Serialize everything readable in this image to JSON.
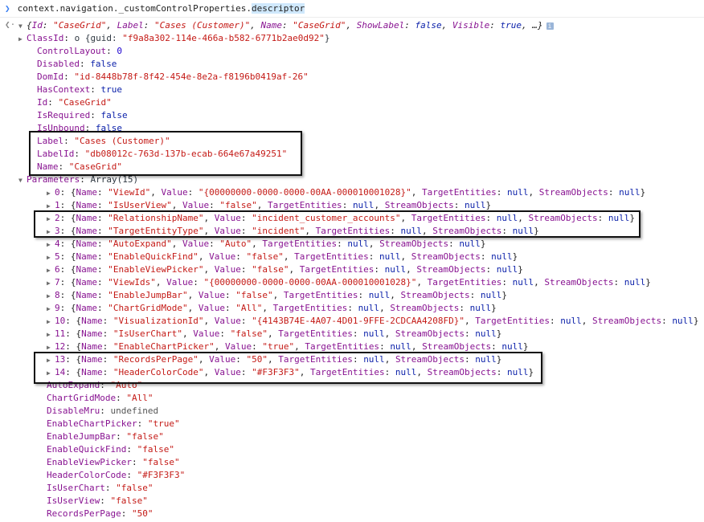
{
  "prompt": {
    "expression_prefix": "context.navigation._customControlProperties.",
    "expression_selected": "descriptor"
  },
  "summary": {
    "open": "{",
    "id_key": "Id",
    "id_val": "\"CaseGrid\"",
    "label_key": "Label",
    "label_val": "\"Cases (Customer)\"",
    "name_key": "Name",
    "name_val": "\"CaseGrid\"",
    "showlabel_key": "ShowLabel",
    "showlabel_val": "false",
    "visible_key": "Visible",
    "visible_val": "true",
    "tail": "…}",
    "info": "i"
  },
  "props_top": [
    {
      "key": "ClassId",
      "expandable": true,
      "prefix": "o ",
      "value": "{guid: ",
      "str": "\"f9a8a302-114e-466a-b582-6771b2ae0d92\"",
      "suffix": "}",
      "vtype": "plain"
    },
    {
      "key": "ControlLayout",
      "value": "0",
      "vtype": "num"
    },
    {
      "key": "Disabled",
      "value": "false",
      "vtype": "kw"
    },
    {
      "key": "DomId",
      "value": "\"id-8448b78f-8f42-454e-8e2a-f8196b0419af-26\"",
      "vtype": "str"
    },
    {
      "key": "HasContext",
      "value": "true",
      "vtype": "kw"
    },
    {
      "key": "Id",
      "value": "\"CaseGrid\"",
      "vtype": "str"
    },
    {
      "key": "IsRequired",
      "value": "false",
      "vtype": "kw"
    },
    {
      "key": "IsUnbound",
      "value": "false",
      "vtype": "kw"
    },
    {
      "key": "Label",
      "value": "\"Cases (Customer)\"",
      "vtype": "str"
    },
    {
      "key": "LabelId",
      "value": "\"db08012c-763d-137b-ecab-664e67a49251\"",
      "vtype": "str"
    },
    {
      "key": "Name",
      "value": "\"CaseGrid\"",
      "vtype": "str"
    }
  ],
  "parameters": {
    "key": "Parameters",
    "value": "Array(15)"
  },
  "param_items": [
    {
      "index": "0",
      "name": "\"ViewId\"",
      "value": "\"{00000000-0000-0000-00AA-000010001028}\""
    },
    {
      "index": "1",
      "name": "\"IsUserView\"",
      "value": "\"false\""
    },
    {
      "index": "2",
      "name": "\"RelationshipName\"",
      "value": "\"incident_customer_accounts\""
    },
    {
      "index": "3",
      "name": "\"TargetEntityType\"",
      "value": "\"incident\""
    },
    {
      "index": "4",
      "name": "\"AutoExpand\"",
      "value": "\"Auto\""
    },
    {
      "index": "5",
      "name": "\"EnableQuickFind\"",
      "value": "\"false\""
    },
    {
      "index": "6",
      "name": "\"EnableViewPicker\"",
      "value": "\"false\""
    },
    {
      "index": "7",
      "name": "\"ViewIds\"",
      "value": "\"{00000000-0000-0000-00AA-000010001028}\""
    },
    {
      "index": "8",
      "name": "\"EnableJumpBar\"",
      "value": "\"false\""
    },
    {
      "index": "9",
      "name": "\"ChartGridMode\"",
      "value": "\"All\""
    },
    {
      "index": "10",
      "name": "\"VisualizationId\"",
      "value": "\"{4143B74E-4A07-4D01-9FFE-2CDCAA4208FD}\""
    },
    {
      "index": "11",
      "name": "\"IsUserChart\"",
      "value": "\"false\""
    },
    {
      "index": "12",
      "name": "\"EnableChartPicker\"",
      "value": "\"true\""
    },
    {
      "index": "13",
      "name": "\"RecordsPerPage\"",
      "value": "\"50\""
    },
    {
      "index": "14",
      "name": "\"HeaderColorCode\"",
      "value": "\"#F3F3F3\""
    }
  ],
  "param_labels": {
    "name_key": "Name",
    "value_key": "Value",
    "target_key": "TargetEntities",
    "stream_key": "StreamObjects",
    "null_val": "null"
  },
  "props_bottom": [
    {
      "key": "AutoExpand",
      "value": "\"Auto\"",
      "vtype": "str"
    },
    {
      "key": "ChartGridMode",
      "value": "\"All\"",
      "vtype": "str"
    },
    {
      "key": "DisableMru",
      "value": "undefined",
      "vtype": "grey"
    },
    {
      "key": "EnableChartPicker",
      "value": "\"true\"",
      "vtype": "str"
    },
    {
      "key": "EnableJumpBar",
      "value": "\"false\"",
      "vtype": "str"
    },
    {
      "key": "EnableQuickFind",
      "value": "\"false\"",
      "vtype": "str"
    },
    {
      "key": "EnableViewPicker",
      "value": "\"false\"",
      "vtype": "str"
    },
    {
      "key": "HeaderColorCode",
      "value": "\"#F3F3F3\"",
      "vtype": "str"
    },
    {
      "key": "IsUserChart",
      "value": "\"false\"",
      "vtype": "str"
    },
    {
      "key": "IsUserView",
      "value": "\"false\"",
      "vtype": "str"
    },
    {
      "key": "RecordsPerPage",
      "value": "\"50\"",
      "vtype": "str"
    }
  ],
  "icons": {
    "expand": "triangle-right",
    "collapse": "triangle-down",
    "prompt": "chevron-right",
    "result": "back-arrow"
  },
  "colors": {
    "key": "#881391",
    "string": "#c41a16",
    "number": "#1c00cf",
    "keyword": "#0d22aa",
    "selection": "#cfe8fc"
  }
}
